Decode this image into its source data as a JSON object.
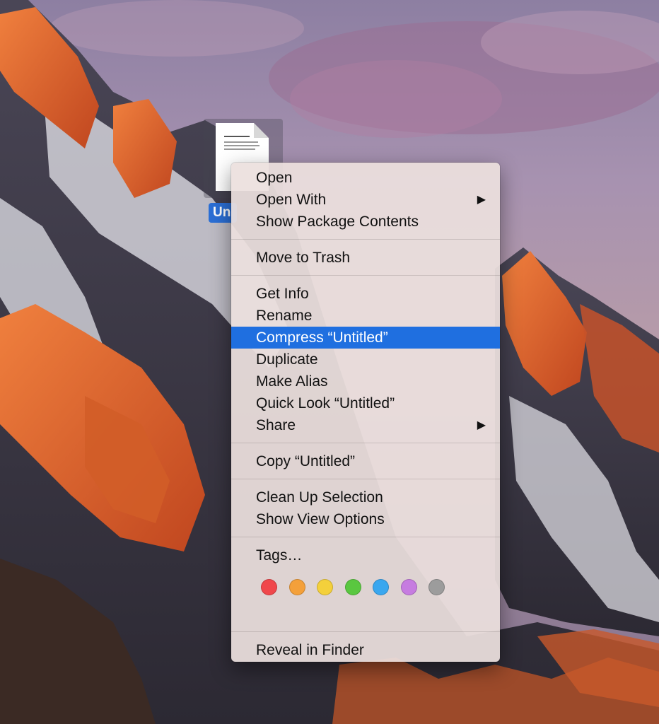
{
  "desktop": {
    "file": {
      "label": "Un",
      "icon": "document-icon"
    }
  },
  "menu": {
    "group1": [
      {
        "label": "Open",
        "submenu": false
      },
      {
        "label": "Open With",
        "submenu": true
      },
      {
        "label": "Show Package Contents",
        "submenu": false
      }
    ],
    "group2": [
      {
        "label": "Move to Trash",
        "submenu": false
      }
    ],
    "group3": [
      {
        "label": "Get Info",
        "submenu": false
      },
      {
        "label": "Rename",
        "submenu": false
      },
      {
        "label": "Compress “Untitled”",
        "submenu": false,
        "highlighted": true
      },
      {
        "label": "Duplicate",
        "submenu": false
      },
      {
        "label": "Make Alias",
        "submenu": false
      },
      {
        "label": "Quick Look “Untitled”",
        "submenu": false
      },
      {
        "label": "Share",
        "submenu": true
      }
    ],
    "group4": [
      {
        "label": "Copy “Untitled”",
        "submenu": false
      }
    ],
    "group5": [
      {
        "label": "Clean Up Selection",
        "submenu": false
      },
      {
        "label": "Show View Options",
        "submenu": false
      }
    ],
    "group6": [
      {
        "label": "Tags…",
        "submenu": false
      }
    ],
    "tags": [
      {
        "name": "red",
        "color": "#f0474b"
      },
      {
        "name": "orange",
        "color": "#f4a03a"
      },
      {
        "name": "yellow",
        "color": "#f4d03b"
      },
      {
        "name": "green",
        "color": "#5ac740"
      },
      {
        "name": "blue",
        "color": "#3aa7ef"
      },
      {
        "name": "purple",
        "color": "#c67ce0"
      },
      {
        "name": "gray",
        "color": "#9c9c9c"
      }
    ],
    "group7": [
      {
        "label": "Reveal in Finder",
        "submenu": false
      }
    ],
    "submenu_arrow": "▶"
  },
  "colors": {
    "highlight": "#1f6fe0",
    "selection_label": "#2b6fd6"
  }
}
